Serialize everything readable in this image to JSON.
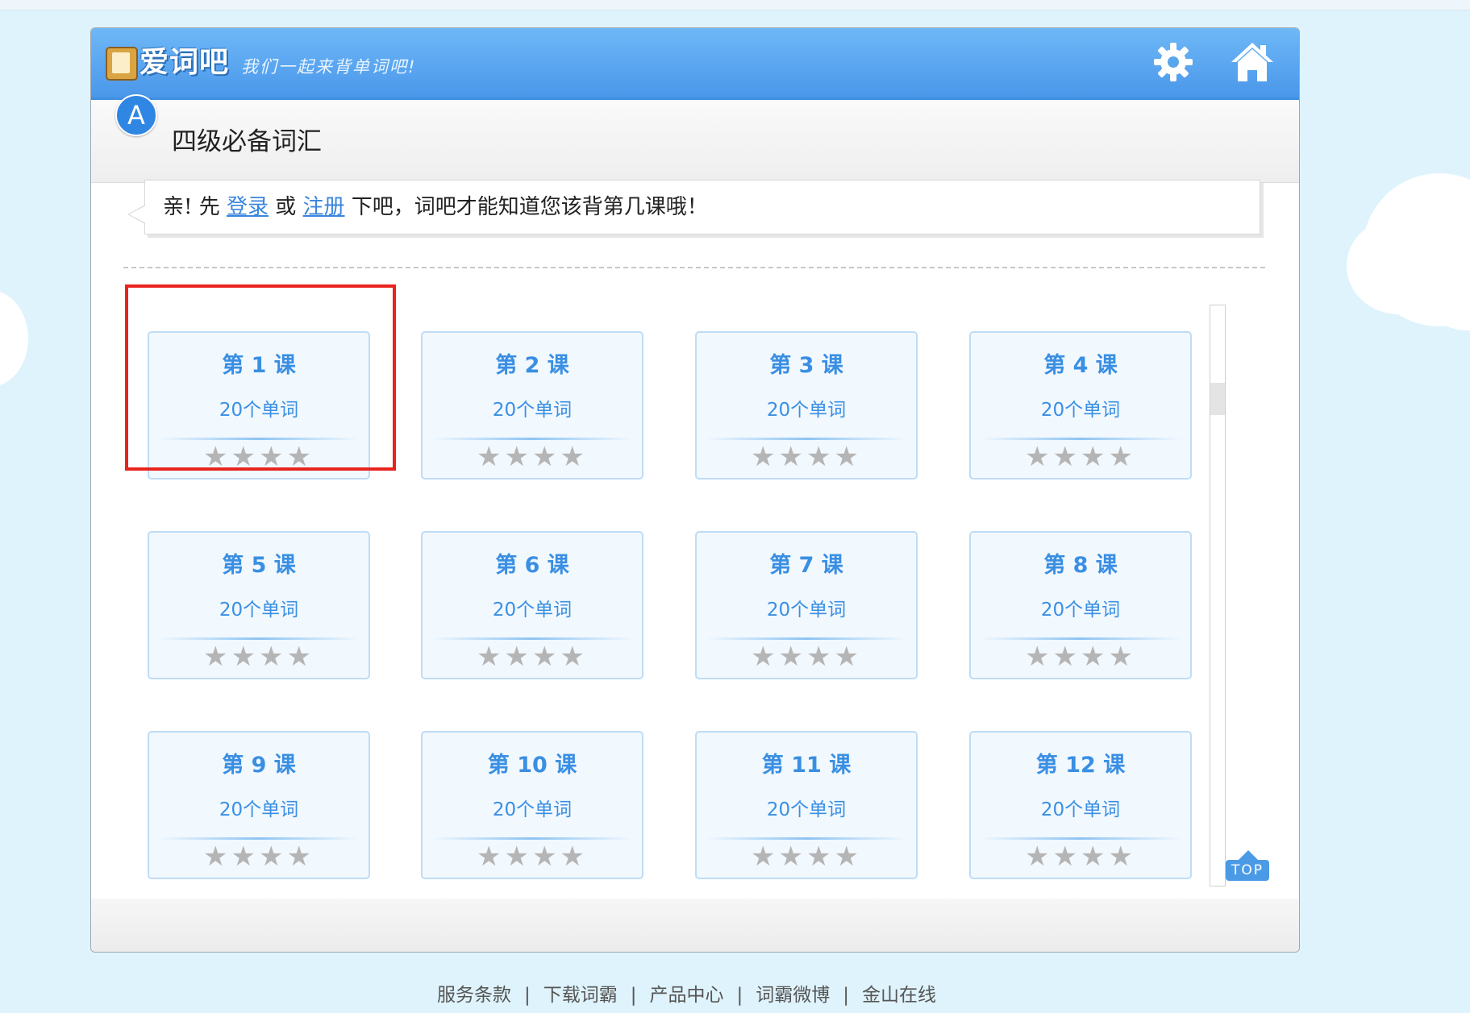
{
  "header": {
    "logo_text": "爱词吧",
    "slogan": "我们一起来背单词吧!",
    "settings_icon": "gear-icon",
    "home_icon": "home-icon",
    "brand_color": "#4a97ea"
  },
  "title": {
    "badge": "A",
    "text": "四级必备词汇"
  },
  "notice": {
    "prefix": "亲! 先 ",
    "login": "登录",
    "middle": " 或 ",
    "register": "注册",
    "suffix": " 下吧，词吧才能知道您该背第几课哦！"
  },
  "lessons": [
    {
      "prefix": "第",
      "num": "1",
      "suffix": "课",
      "words": "20个单词",
      "stars": "★★★★"
    },
    {
      "prefix": "第",
      "num": "2",
      "suffix": "课",
      "words": "20个单词",
      "stars": "★★★★"
    },
    {
      "prefix": "第",
      "num": "3",
      "suffix": "课",
      "words": "20个单词",
      "stars": "★★★★"
    },
    {
      "prefix": "第",
      "num": "4",
      "suffix": "课",
      "words": "20个单词",
      "stars": "★★★★"
    },
    {
      "prefix": "第",
      "num": "5",
      "suffix": "课",
      "words": "20个单词",
      "stars": "★★★★"
    },
    {
      "prefix": "第",
      "num": "6",
      "suffix": "课",
      "words": "20个单词",
      "stars": "★★★★"
    },
    {
      "prefix": "第",
      "num": "7",
      "suffix": "课",
      "words": "20个单词",
      "stars": "★★★★"
    },
    {
      "prefix": "第",
      "num": "8",
      "suffix": "课",
      "words": "20个单词",
      "stars": "★★★★"
    },
    {
      "prefix": "第",
      "num": "9",
      "suffix": "课",
      "words": "20个单词",
      "stars": "★★★★"
    },
    {
      "prefix": "第",
      "num": "10",
      "suffix": "课",
      "words": "20个单词",
      "stars": "★★★★"
    },
    {
      "prefix": "第",
      "num": "11",
      "suffix": "课",
      "words": "20个单词",
      "stars": "★★★★"
    },
    {
      "prefix": "第",
      "num": "12",
      "suffix": "课",
      "words": "20个单词",
      "stars": "★★★★"
    }
  ],
  "selected_lesson": 1,
  "top_button": "TOP",
  "footer": {
    "links": [
      "服务条款",
      "下载词霸",
      "产品中心",
      "词霸微博",
      "金山在线"
    ],
    "separator": "|"
  },
  "colors": {
    "accent": "#3a8fe3",
    "selection": "#e8231d",
    "star_empty": "#b5b5b5"
  }
}
